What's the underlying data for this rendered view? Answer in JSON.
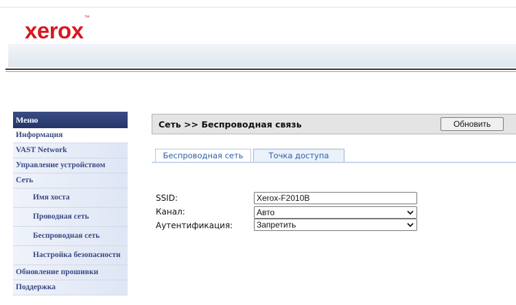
{
  "brand": {
    "logo_text": "xerox",
    "tm": "™",
    "logo_color": "#d71920"
  },
  "menu": {
    "header": "Меню",
    "items": [
      {
        "label": "Информация",
        "level": "top"
      },
      {
        "label": "VAST Network",
        "level": "top"
      },
      {
        "label": "Управление устройством",
        "level": "top"
      },
      {
        "label": "Сеть",
        "level": "top"
      },
      {
        "label": "Имя хоста",
        "level": "sub"
      },
      {
        "label": "Проводная сеть",
        "level": "sub"
      },
      {
        "label": "Беспроводная сеть",
        "level": "sub"
      },
      {
        "label": "Настройка безопасности",
        "level": "sub"
      },
      {
        "label": "Обновление прошивки",
        "level": "top"
      },
      {
        "label": "Поддержка",
        "level": "top"
      }
    ]
  },
  "page": {
    "breadcrumb": "Сеть >> Беспроводная связь",
    "refresh_label": "Обновить"
  },
  "tabs": [
    {
      "label": "Беспроводная сеть",
      "active": false
    },
    {
      "label": "Точка доступа",
      "active": true
    }
  ],
  "form": {
    "ssid_label": "SSID:",
    "ssid_value": "Xerox-F2010B",
    "channel_label": "Канал:",
    "channel_value": "Авто",
    "auth_label": "Аутентификация:",
    "auth_value": "Запретить"
  },
  "colors": {
    "menu_header": "#2b3a72",
    "menu_text": "#3a4a86",
    "tab_text": "#2b5fa8"
  }
}
